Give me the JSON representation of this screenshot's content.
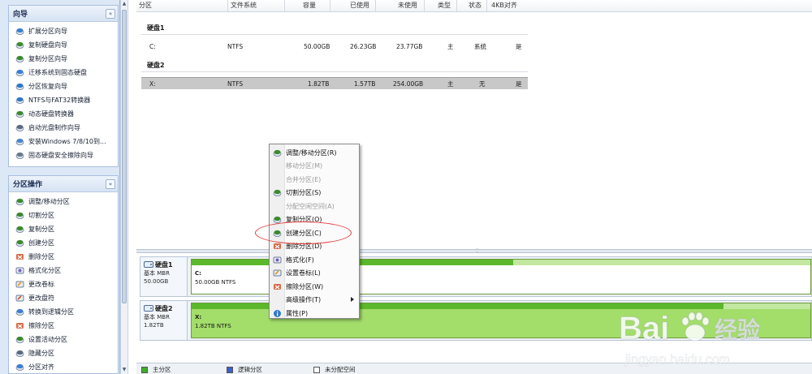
{
  "wizard_panel": {
    "title": "向导",
    "collapse_glyph": "«",
    "items": [
      {
        "label": "扩展分区向导",
        "icon": "extend-partition-icon",
        "color": "#3b7fd4"
      },
      {
        "label": "复制硬盘向导",
        "icon": "copy-disk-icon",
        "color": "#3b8a2d"
      },
      {
        "label": "复制分区向导",
        "icon": "copy-partition-icon",
        "color": "#3b8a2d"
      },
      {
        "label": "迁移系统到固态硬盘",
        "icon": "migrate-os-icon",
        "color": "#3b7fd4"
      },
      {
        "label": "分区恢复向导",
        "icon": "partition-recovery-icon",
        "color": "#2f78c8"
      },
      {
        "label": "NTFS与FAT32转换器",
        "icon": "ntfs-fat32-converter-icon",
        "color": "#2f78c8"
      },
      {
        "label": "动态硬盘转换器",
        "icon": "dynamic-disk-converter-icon",
        "color": "#3b8a2d"
      },
      {
        "label": "启动光盘制作向导",
        "icon": "bootable-cd-icon",
        "color": "#5a6b7e"
      },
      {
        "label": "安装Windows 7/8/10到...",
        "icon": "install-windows-icon",
        "color": "#4a86c9"
      },
      {
        "label": "固态硬盘安全擦除向导",
        "icon": "ssd-secure-erase-icon",
        "color": "#6a7a8c"
      }
    ]
  },
  "partition_ops_panel": {
    "title": "分区操作",
    "collapse_glyph": "«",
    "items": [
      {
        "label": "调整/移动分区",
        "icon": "resize-move-icon",
        "color": "#3b8a2d"
      },
      {
        "label": "切割分区",
        "icon": "split-partition-icon",
        "color": "#3b8a2d"
      },
      {
        "label": "复制分区",
        "icon": "copy-partition-icon",
        "color": "#3b8a2d"
      },
      {
        "label": "创建分区",
        "icon": "create-partition-icon",
        "color": "#3b8a2d"
      },
      {
        "label": "删除分区",
        "icon": "delete-partition-icon",
        "color": "#d0522a"
      },
      {
        "label": "格式化分区",
        "icon": "format-partition-icon",
        "color": "#7a5fc0"
      },
      {
        "label": "更改卷标",
        "icon": "change-label-icon",
        "color": "#e09a1c"
      },
      {
        "label": "更改盘符",
        "icon": "change-drive-letter-icon",
        "color": "#d0522a"
      },
      {
        "label": "转换到逻辑分区",
        "icon": "convert-logical-icon",
        "color": "#3b7fd4"
      },
      {
        "label": "擦除分区",
        "icon": "wipe-partition-icon",
        "color": "#d0522a"
      },
      {
        "label": "设置活动分区",
        "icon": "set-active-icon",
        "color": "#3b8a2d"
      },
      {
        "label": "隐藏分区",
        "icon": "hide-partition-icon",
        "color": "#5a6b7e"
      },
      {
        "label": "分区对齐",
        "icon": "align-partition-icon",
        "color": "#3b7fd4"
      }
    ]
  },
  "table": {
    "columns": [
      "分区",
      "文件系统",
      "容量",
      "已使用",
      "未使用",
      "类型",
      "状态",
      "4KB对齐"
    ],
    "groups": [
      {
        "title": "硬盘1",
        "rows": [
          {
            "partition": "C:",
            "fs": "NTFS",
            "capacity": "50.00GB",
            "used": "26.23GB",
            "unused": "23.77GB",
            "type": "主",
            "status": "系统",
            "aligned": "是"
          }
        ]
      },
      {
        "title": "硬盘2",
        "rows": [
          {
            "partition": "X:",
            "fs": "NTFS",
            "capacity": "1.82TB",
            "used": "1.57TB",
            "unused": "254.00GB",
            "type": "主",
            "status": "无",
            "aligned": "是"
          }
        ]
      }
    ]
  },
  "disk_map": [
    {
      "name": "硬盘1",
      "scheme": "基本 MBR",
      "size": "50.00GB",
      "partition_label": "C:",
      "partition_detail": "50.00GB NTFS",
      "used_fraction": 0.52
    },
    {
      "name": "硬盘2",
      "scheme": "基本 MBR",
      "size": "1.82TB",
      "partition_label": "X:",
      "partition_detail": "1.82TB NTFS",
      "used_fraction": 0.86
    }
  ],
  "legend": [
    {
      "label": "主分区",
      "color": "#3fae2a"
    },
    {
      "label": "逻辑分区",
      "color": "#3a5fcf"
    },
    {
      "label": "未分配空间",
      "color": "#ffffff"
    }
  ],
  "context_menu": {
    "items": [
      {
        "label": "调整/移动分区(R)",
        "enabled": true,
        "icon": "resize-move-icon",
        "color": "#3b8a2d"
      },
      {
        "label": "移动分区(M)",
        "enabled": false
      },
      {
        "label": "合并分区(E)",
        "enabled": false
      },
      {
        "label": "切割分区(S)",
        "enabled": true,
        "icon": "split-partition-icon",
        "color": "#3b8a2d"
      },
      {
        "label": "分配空闲空间(A)",
        "enabled": false
      },
      {
        "label": "复制分区(O)",
        "enabled": true,
        "icon": "copy-partition-icon",
        "color": "#3b8a2d"
      },
      {
        "label": "创建分区(C)",
        "enabled": true,
        "icon": "create-partition-icon",
        "color": "#3b8a2d",
        "highlighted": true
      },
      {
        "label": "删除分区(D)",
        "enabled": true,
        "icon": "delete-partition-icon",
        "color": "#d0522a"
      },
      {
        "label": "格式化(F)",
        "enabled": true,
        "icon": "format-partition-icon",
        "color": "#7a5fc0"
      },
      {
        "label": "设置卷标(L)",
        "enabled": true,
        "icon": "change-label-icon",
        "color": "#e09a1c"
      },
      {
        "label": "擦除分区(W)",
        "enabled": true,
        "icon": "wipe-partition-icon",
        "color": "#d0522a"
      },
      {
        "label": "高级操作(T)",
        "enabled": true,
        "submenu": true
      },
      {
        "label": "属性(P)",
        "enabled": true,
        "icon": "properties-icon",
        "color": "#2f78c8"
      }
    ]
  },
  "watermark": {
    "text": "Bai",
    "text2": "经验",
    "url": "jingyan.baidu.com"
  }
}
